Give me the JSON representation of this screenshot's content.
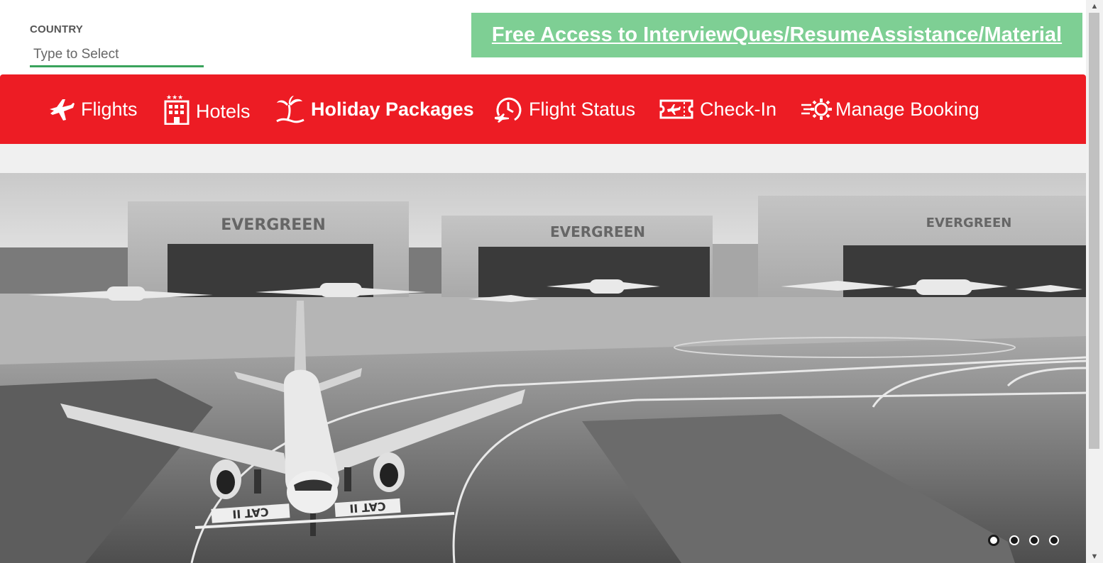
{
  "country": {
    "label": "COUNTRY",
    "placeholder": "Type to Select"
  },
  "promo": {
    "text": "Free Access to InterviewQues/ResumeAssistance/Material"
  },
  "nav": {
    "items": [
      {
        "label": "Flights",
        "icon": "airplane-icon"
      },
      {
        "label": "Hotels",
        "icon": "hotel-icon"
      },
      {
        "label": "Holiday Packages",
        "icon": "palm-tree-icon"
      },
      {
        "label": "Flight Status",
        "icon": "clock-plane-icon"
      },
      {
        "label": "Check-In",
        "icon": "ticket-icon"
      },
      {
        "label": "Manage Booking",
        "icon": "gear-icon"
      }
    ]
  },
  "hero": {
    "hangar_sign": "EVERGREEN",
    "runway_marking": "CAT II",
    "slide_count": 4,
    "active_slide": 1
  },
  "colors": {
    "nav_bg": "#ed1c24",
    "promo_bg": "#7ecf94",
    "input_underline": "#3aa35c"
  }
}
